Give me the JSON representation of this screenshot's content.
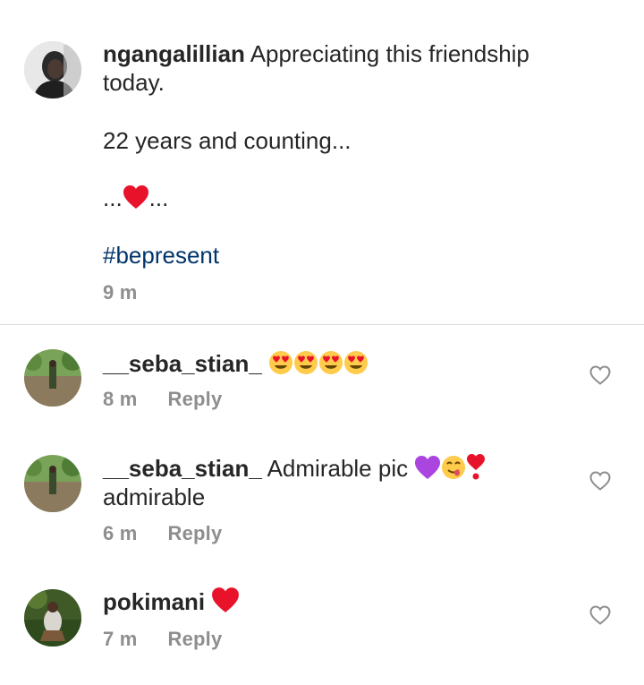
{
  "caption": {
    "username": "ngangalillian",
    "line1": "Appreciating this friendship",
    "line2": "today.",
    "line3": "22 years and counting...",
    "line4_prefix": "...",
    "line4_suffix": "...",
    "hashtag": "#bepresent",
    "time": "9 m",
    "avatar_icon": "profile-photo-woman"
  },
  "comments": [
    {
      "username": "__seba_stian_",
      "text": "",
      "emojis": [
        "heart-eyes-emoji",
        "heart-eyes-emoji",
        "heart-eyes-emoji",
        "heart-eyes-emoji"
      ],
      "time": "8 m",
      "reply": "Reply"
    },
    {
      "username": "__seba_stian_",
      "text": "Admirable pic",
      "text2": "admirable",
      "emojis": [
        "purple-heart-emoji",
        "yum-face-emoji",
        "exclamation-heart-emoji"
      ],
      "time": "6 m",
      "reply": "Reply"
    },
    {
      "username": "pokimani",
      "text": "",
      "emojis": [
        "red-heart-emoji"
      ],
      "time": "7 m",
      "reply": "Reply"
    }
  ],
  "colors": {
    "text": "#262626",
    "meta": "#8e8e8e",
    "hashtag": "#003569",
    "divider": "#dbdbdb"
  }
}
